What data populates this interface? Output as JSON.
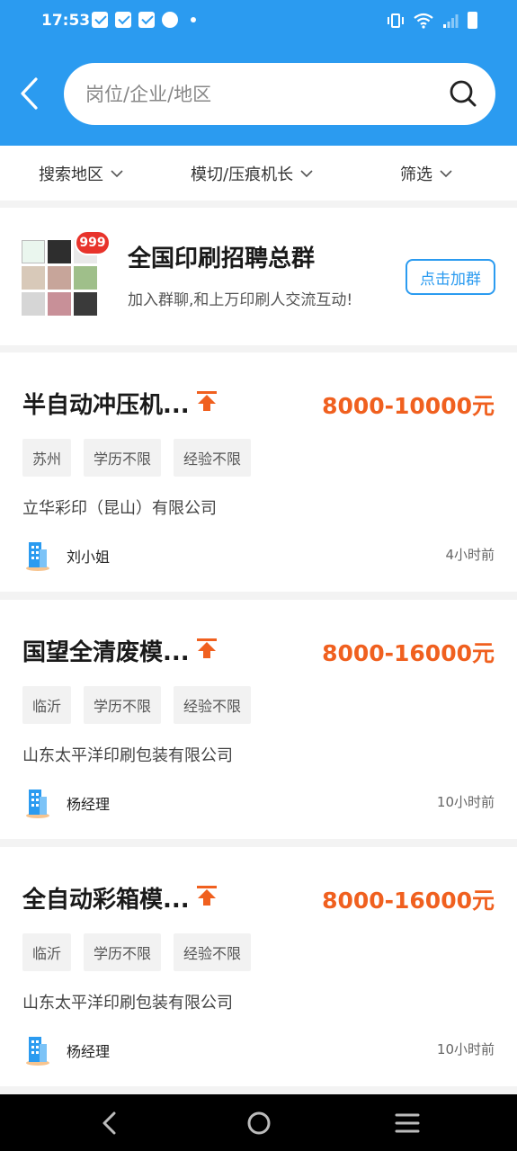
{
  "status_bar": {
    "time": "17:53"
  },
  "search": {
    "placeholder": "岗位/企业/地区"
  },
  "filters": [
    {
      "label": "搜索地区"
    },
    {
      "label": "模切/压痕机长"
    },
    {
      "label": "筛选"
    }
  ],
  "group": {
    "badge": "999",
    "title": "全国印刷招聘总群",
    "subtitle": "加入群聊,和上万印刷人交流互动!",
    "join_label": "点击加群"
  },
  "jobs": [
    {
      "title": "半自动冲压机...",
      "salary": "8000-10000元",
      "tags": [
        "苏州",
        "学历不限",
        "经验不限"
      ],
      "company": "立华彩印（昆山）有限公司",
      "contact": "刘小姐",
      "time": "4小时前"
    },
    {
      "title": "国望全清废模...",
      "salary": "8000-16000元",
      "tags": [
        "临沂",
        "学历不限",
        "经验不限"
      ],
      "company": "山东太平洋印刷包装有限公司",
      "contact": "杨经理",
      "time": "10小时前"
    },
    {
      "title": "全自动彩箱模...",
      "salary": "8000-16000元",
      "tags": [
        "临沂",
        "学历不限",
        "经验不限"
      ],
      "company": "山东太平洋印刷包装有限公司",
      "contact": "杨经理",
      "time": "10小时前"
    }
  ],
  "colors": {
    "primary": "#2b9bf0",
    "salary": "#f0601f",
    "badge": "#e8332b"
  }
}
